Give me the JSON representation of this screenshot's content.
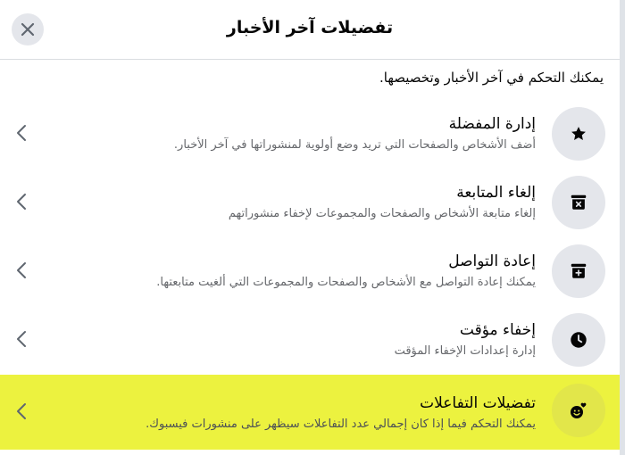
{
  "dialog": {
    "title": "تفضيلات آخر الأخبار",
    "close_icon": "close-icon",
    "intro": "يمكنك التحكم في آخر الأخبار وتخصيصها."
  },
  "rows": [
    {
      "title": "إدارة المفضلة",
      "description": "أضف الأشخاص والصفحات التي تريد وضع أولوية لمنشوراتها في آخر الأخبار.",
      "icon": "star-icon"
    },
    {
      "title": "إلغاء المتابعة",
      "description": "إلغاء متابعة الأشخاص والصفحات والمجموعات لإخفاء منشوراتهم",
      "icon": "box-remove-icon"
    },
    {
      "title": "إعادة التواصل",
      "description": "يمكنك إعادة التواصل مع الأشخاص والصفحات والمجموعات التي ألغيت متابعتها.",
      "icon": "box-add-icon"
    },
    {
      "title": "إخفاء مؤقت",
      "description": "إدارة إعدادات الإخفاء المؤقت",
      "icon": "clock-icon"
    },
    {
      "title": "تفضيلات التفاعلات",
      "description": "يمكنك التحكم فيما إذا كان إجمالي عدد التفاعلات سيظهر على منشورات فيسبوك.",
      "icon": "reactions-icon"
    }
  ],
  "colors": {
    "highlight": "#ecf23f",
    "icon_bg": "#e4e6eb",
    "secondary_text": "#65676b"
  }
}
